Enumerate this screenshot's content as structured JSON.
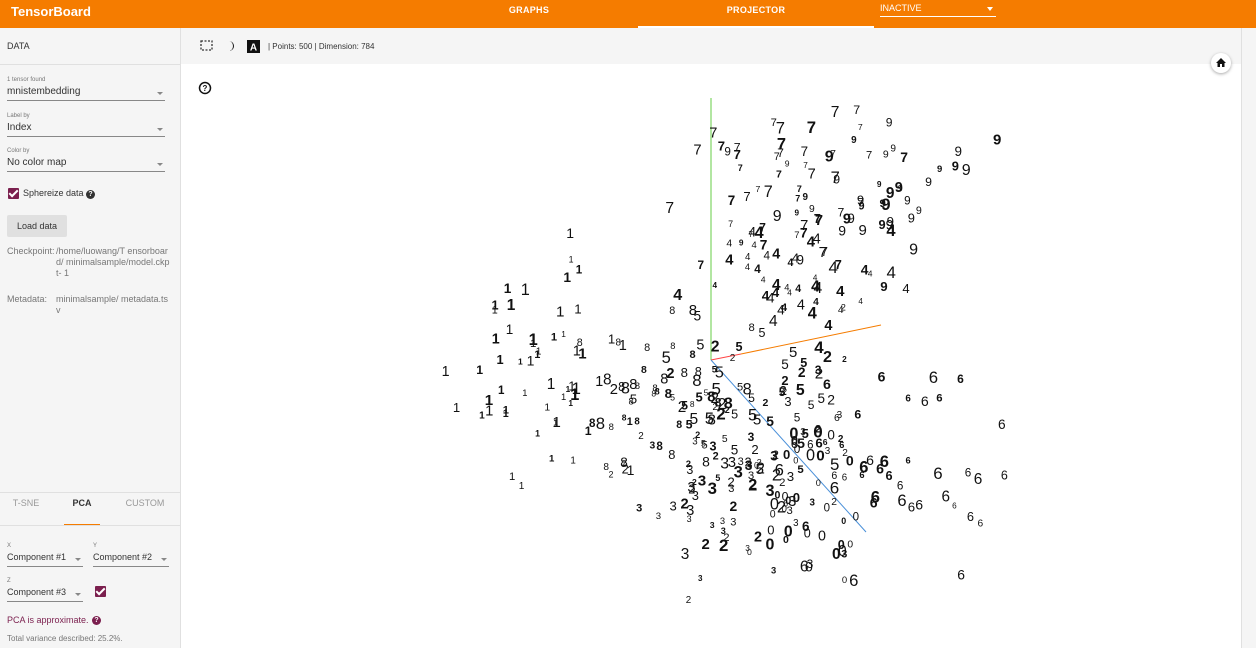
{
  "header": {
    "brand": "TensorBoard",
    "tabs": [
      {
        "label": "GRAPHS",
        "active": false
      },
      {
        "label": "PROJECTOR",
        "active": true
      }
    ],
    "run_select": "INACTIVE"
  },
  "data_panel": {
    "title": "DATA",
    "tensor_found": "1 tensor found",
    "tensor": "mnistembedding",
    "label_by_label": "Label by",
    "label_by": "Index",
    "color_by_label": "Color by",
    "color_by": "No color map",
    "spherize": "Sphereize data",
    "spherize_checked": true,
    "load_button": "Load data",
    "checkpoint_label": "Checkpoint:",
    "checkpoint_value": "/home/luowang/T ensorboard/ minimalsample/model.ckpt- 1",
    "metadata_label": "Metadata:",
    "metadata_value": "minimalsample/ metadata.tsv"
  },
  "projection_panel": {
    "tabs": [
      "T-SNE",
      "PCA",
      "CUSTOM"
    ],
    "active_tab": "PCA",
    "x_label": "X",
    "x_value": "Component #1",
    "y_label": "Y",
    "y_value": "Component #2",
    "z_label": "Z",
    "z_value": "Component #3",
    "z_checked": true,
    "approx_note": "PCA is approximate.",
    "variance": "Total variance described: 25.2%."
  },
  "toolbar": {
    "status": "| Points: 500 | Dimension: 784",
    "icons": [
      "select-rectangle-icon",
      "night-mode-icon",
      "label-icon"
    ]
  },
  "canvas": {
    "help_icon": "help-icon",
    "home_icon": "home-icon",
    "accent": "#f57c00",
    "theme": "#7b1f4e",
    "axis_colors": {
      "x": "#ff4444",
      "y": "#66cc44",
      "z": "#4a90d9",
      "extra": "#f57c00"
    }
  }
}
